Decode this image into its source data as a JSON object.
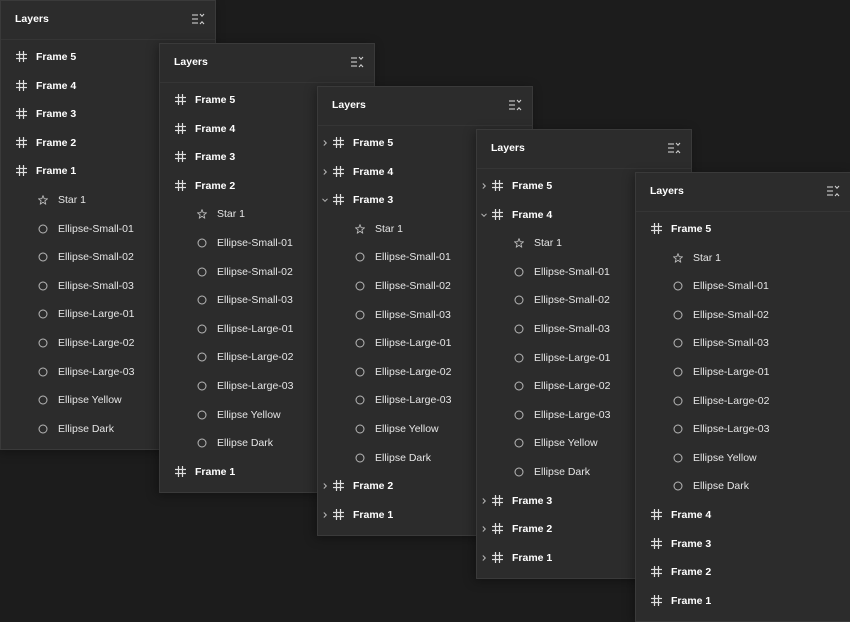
{
  "colors": {
    "background": "#1c1c1c",
    "panel": "#2c2c2c",
    "text": "#ffffff",
    "icon": "#b8b8b8"
  },
  "panels": [
    {
      "title": "Layers",
      "rows": [
        {
          "label": "Frame 5",
          "type": "frame",
          "depth": 0,
          "chevron": ""
        },
        {
          "label": "Frame 4",
          "type": "frame",
          "depth": 0,
          "chevron": ""
        },
        {
          "label": "Frame 3",
          "type": "frame",
          "depth": 0,
          "chevron": ""
        },
        {
          "label": "Frame 2",
          "type": "frame",
          "depth": 0,
          "chevron": ""
        },
        {
          "label": "Frame 1",
          "type": "frame",
          "depth": 0,
          "chevron": ""
        },
        {
          "label": "Star 1",
          "type": "star",
          "depth": 1
        },
        {
          "label": "Ellipse-Small-01",
          "type": "ellipse",
          "depth": 1
        },
        {
          "label": "Ellipse-Small-02",
          "type": "ellipse",
          "depth": 1
        },
        {
          "label": "Ellipse-Small-03",
          "type": "ellipse",
          "depth": 1
        },
        {
          "label": "Ellipse-Large-01",
          "type": "ellipse",
          "depth": 1
        },
        {
          "label": "Ellipse-Large-02",
          "type": "ellipse",
          "depth": 1
        },
        {
          "label": "Ellipse-Large-03",
          "type": "ellipse",
          "depth": 1
        },
        {
          "label": "Ellipse Yellow",
          "type": "ellipse",
          "depth": 1
        },
        {
          "label": "Ellipse Dark",
          "type": "ellipse",
          "depth": 1
        }
      ]
    },
    {
      "title": "Layers",
      "rows": [
        {
          "label": "Frame 5",
          "type": "frame",
          "depth": 0,
          "chevron": ""
        },
        {
          "label": "Frame 4",
          "type": "frame",
          "depth": 0,
          "chevron": ""
        },
        {
          "label": "Frame 3",
          "type": "frame",
          "depth": 0,
          "chevron": ""
        },
        {
          "label": "Frame 2",
          "type": "frame",
          "depth": 0,
          "chevron": ""
        },
        {
          "label": "Star 1",
          "type": "star",
          "depth": 1
        },
        {
          "label": "Ellipse-Small-01",
          "type": "ellipse",
          "depth": 1
        },
        {
          "label": "Ellipse-Small-02",
          "type": "ellipse",
          "depth": 1
        },
        {
          "label": "Ellipse-Small-03",
          "type": "ellipse",
          "depth": 1
        },
        {
          "label": "Ellipse-Large-01",
          "type": "ellipse",
          "depth": 1
        },
        {
          "label": "Ellipse-Large-02",
          "type": "ellipse",
          "depth": 1
        },
        {
          "label": "Ellipse-Large-03",
          "type": "ellipse",
          "depth": 1
        },
        {
          "label": "Ellipse Yellow",
          "type": "ellipse",
          "depth": 1
        },
        {
          "label": "Ellipse Dark",
          "type": "ellipse",
          "depth": 1
        },
        {
          "label": "Frame 1",
          "type": "frame",
          "depth": 0,
          "chevron": ""
        }
      ]
    },
    {
      "title": "Layers",
      "rows": [
        {
          "label": "Frame 5",
          "type": "frame",
          "depth": 0,
          "chevron": "right"
        },
        {
          "label": "Frame 4",
          "type": "frame",
          "depth": 0,
          "chevron": "right"
        },
        {
          "label": "Frame 3",
          "type": "frame",
          "depth": 0,
          "chevron": "down"
        },
        {
          "label": "Star 1",
          "type": "star",
          "depth": 1
        },
        {
          "label": "Ellipse-Small-01",
          "type": "ellipse",
          "depth": 1
        },
        {
          "label": "Ellipse-Small-02",
          "type": "ellipse",
          "depth": 1
        },
        {
          "label": "Ellipse-Small-03",
          "type": "ellipse",
          "depth": 1
        },
        {
          "label": "Ellipse-Large-01",
          "type": "ellipse",
          "depth": 1
        },
        {
          "label": "Ellipse-Large-02",
          "type": "ellipse",
          "depth": 1
        },
        {
          "label": "Ellipse-Large-03",
          "type": "ellipse",
          "depth": 1
        },
        {
          "label": "Ellipse Yellow",
          "type": "ellipse",
          "depth": 1
        },
        {
          "label": "Ellipse Dark",
          "type": "ellipse",
          "depth": 1
        },
        {
          "label": "Frame 2",
          "type": "frame",
          "depth": 0,
          "chevron": "right"
        },
        {
          "label": "Frame 1",
          "type": "frame",
          "depth": 0,
          "chevron": "right"
        }
      ]
    },
    {
      "title": "Layers",
      "rows": [
        {
          "label": "Frame 5",
          "type": "frame",
          "depth": 0,
          "chevron": "right"
        },
        {
          "label": "Frame 4",
          "type": "frame",
          "depth": 0,
          "chevron": "down"
        },
        {
          "label": "Star 1",
          "type": "star",
          "depth": 1
        },
        {
          "label": "Ellipse-Small-01",
          "type": "ellipse",
          "depth": 1
        },
        {
          "label": "Ellipse-Small-02",
          "type": "ellipse",
          "depth": 1
        },
        {
          "label": "Ellipse-Small-03",
          "type": "ellipse",
          "depth": 1
        },
        {
          "label": "Ellipse-Large-01",
          "type": "ellipse",
          "depth": 1
        },
        {
          "label": "Ellipse-Large-02",
          "type": "ellipse",
          "depth": 1
        },
        {
          "label": "Ellipse-Large-03",
          "type": "ellipse",
          "depth": 1
        },
        {
          "label": "Ellipse Yellow",
          "type": "ellipse",
          "depth": 1
        },
        {
          "label": "Ellipse Dark",
          "type": "ellipse",
          "depth": 1
        },
        {
          "label": "Frame 3",
          "type": "frame",
          "depth": 0,
          "chevron": "right"
        },
        {
          "label": "Frame 2",
          "type": "frame",
          "depth": 0,
          "chevron": "right"
        },
        {
          "label": "Frame 1",
          "type": "frame",
          "depth": 0,
          "chevron": "right"
        }
      ]
    },
    {
      "title": "Layers",
      "rows": [
        {
          "label": "Frame 5",
          "type": "frame",
          "depth": 0,
          "chevron": ""
        },
        {
          "label": "Star 1",
          "type": "star",
          "depth": 1
        },
        {
          "label": "Ellipse-Small-01",
          "type": "ellipse",
          "depth": 1
        },
        {
          "label": "Ellipse-Small-02",
          "type": "ellipse",
          "depth": 1
        },
        {
          "label": "Ellipse-Small-03",
          "type": "ellipse",
          "depth": 1
        },
        {
          "label": "Ellipse-Large-01",
          "type": "ellipse",
          "depth": 1
        },
        {
          "label": "Ellipse-Large-02",
          "type": "ellipse",
          "depth": 1
        },
        {
          "label": "Ellipse-Large-03",
          "type": "ellipse",
          "depth": 1
        },
        {
          "label": "Ellipse Yellow",
          "type": "ellipse",
          "depth": 1
        },
        {
          "label": "Ellipse Dark",
          "type": "ellipse",
          "depth": 1
        },
        {
          "label": "Frame 4",
          "type": "frame",
          "depth": 0,
          "chevron": ""
        },
        {
          "label": "Frame 3",
          "type": "frame",
          "depth": 0,
          "chevron": ""
        },
        {
          "label": "Frame 2",
          "type": "frame",
          "depth": 0,
          "chevron": ""
        },
        {
          "label": "Frame 1",
          "type": "frame",
          "depth": 0,
          "chevron": ""
        }
      ]
    }
  ]
}
